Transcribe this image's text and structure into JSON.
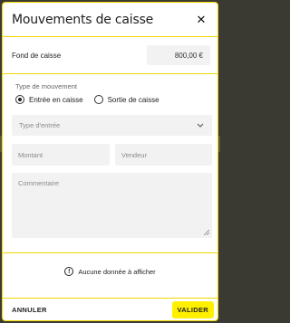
{
  "modal": {
    "title": "Mouvements de caisse",
    "close_icon": "close-icon"
  },
  "fond": {
    "label": "Fond de caisse",
    "value": "800,00 €"
  },
  "mouvement": {
    "section_label": "Type de mouvement",
    "options": [
      {
        "label": "Entrée en caisse",
        "checked": true
      },
      {
        "label": "Sortie de caisse",
        "checked": false
      }
    ],
    "type_select_placeholder": "Type d'entrée",
    "montant_placeholder": "Montant",
    "vendeur_placeholder": "Vendeur",
    "commentaire_placeholder": "Commentaire"
  },
  "empty_state": {
    "icon": "info-icon",
    "text": "Aucune donnée à afficher"
  },
  "footer": {
    "cancel_label": "ANNULER",
    "validate_label": "VALIDER"
  },
  "colors": {
    "accent": "#f0d600",
    "primary_button": "#fff000",
    "field_bg": "#f2f2f2"
  }
}
